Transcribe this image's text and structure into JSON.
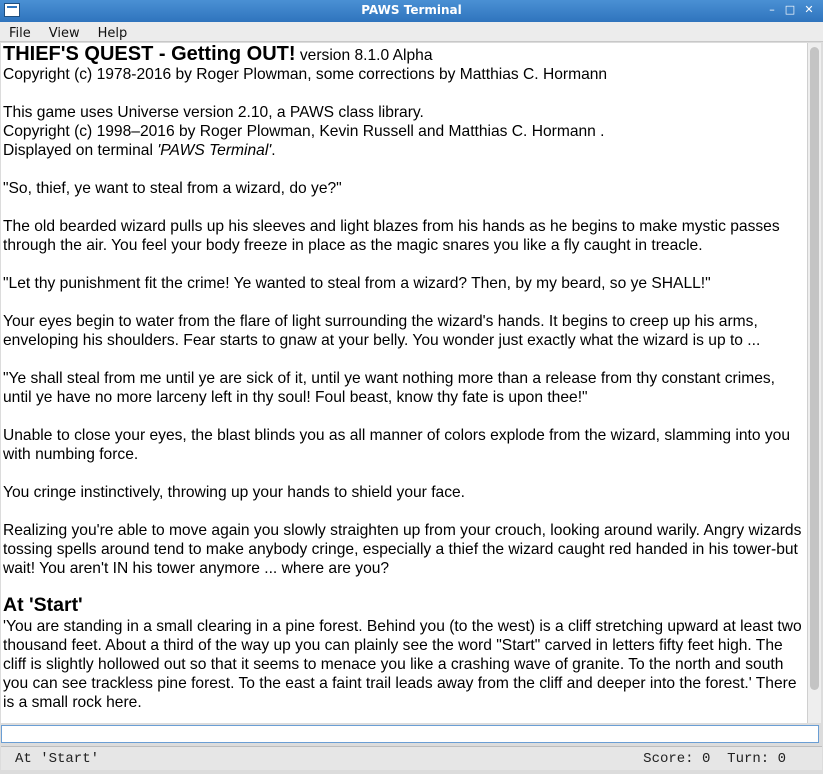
{
  "window": {
    "title": "PAWS Terminal",
    "controls": {
      "minimize": "–",
      "maximize": "□",
      "close": "✕"
    }
  },
  "menu": [
    "File",
    "View",
    "Help"
  ],
  "content": {
    "game_title": "THIEF'S QUEST - Getting OUT!",
    "version": " version 8.1.0 Alpha",
    "copyright1": "Copyright (c) 1978-2016 by Roger Plowman, some corrections by Matthias C. Hormann",
    "universe": "This game uses Universe version 2.10, a PAWS class library.",
    "copyright2": "Copyright (c) 1998–2016 by Roger Plowman, Kevin Russell and Matthias C. Hormann .",
    "displayed_prefix": "Displayed on terminal ",
    "displayed_terminal": "'PAWS Terminal'",
    "displayed_suffix": ".",
    "paragraphs": [
      "\"So, thief, ye want to steal from a wizard, do ye?\"",
      "The old bearded wizard pulls up his sleeves and light blazes from his hands as he begins to make mystic passes through the air. You feel your body freeze in place as the magic snares you like a fly caught in treacle.",
      "\"Let thy punishment fit the crime! Ye wanted to steal from a wizard? Then, by my beard, so ye SHALL!\"",
      "Your eyes begin to water from the flare of light surrounding the wizard's hands. It begins to creep up his arms, enveloping his shoulders. Fear starts to gnaw at your belly. You wonder just exactly what the wizard is up to ...",
      "\"Ye shall steal from me until ye are sick of it, until ye want nothing more than a release from thy constant crimes, until ye have no more larceny left in thy soul! Foul beast, know thy fate is upon thee!\"",
      "Unable to close your eyes, the blast blinds you as all manner of colors explode from the wizard, slamming into you with numbing force.",
      "You cringe instinctively, throwing up your hands to shield your face.",
      "Realizing you're able to move again you slowly straighten up from your crouch, looking around warily. Angry wizards tossing spells around tend to make anybody cringe, especially a thief the wizard caught red handed in his tower-but wait! You aren't IN his tower anymore ... where are you?"
    ],
    "location_heading": "At 'Start'",
    "location_description": "'You are standing in a small clearing in a pine forest. Behind you (to the west) is a cliff stretching upward at least two thousand feet. About a third of the way up you can plainly see the word \"Start\" carved in letters fifty feet high. The cliff is slightly hollowed out so that it seems to menace you like a crashing wave of granite. To the north and south you can see trackless pine forest. To the east a faint trail leads away from the cliff and deeper into the forest.' There is a small rock here."
  },
  "input": {
    "value": ""
  },
  "status": {
    "location": "At 'Start'",
    "score_turn": "Score: 0 Turn: 0"
  }
}
